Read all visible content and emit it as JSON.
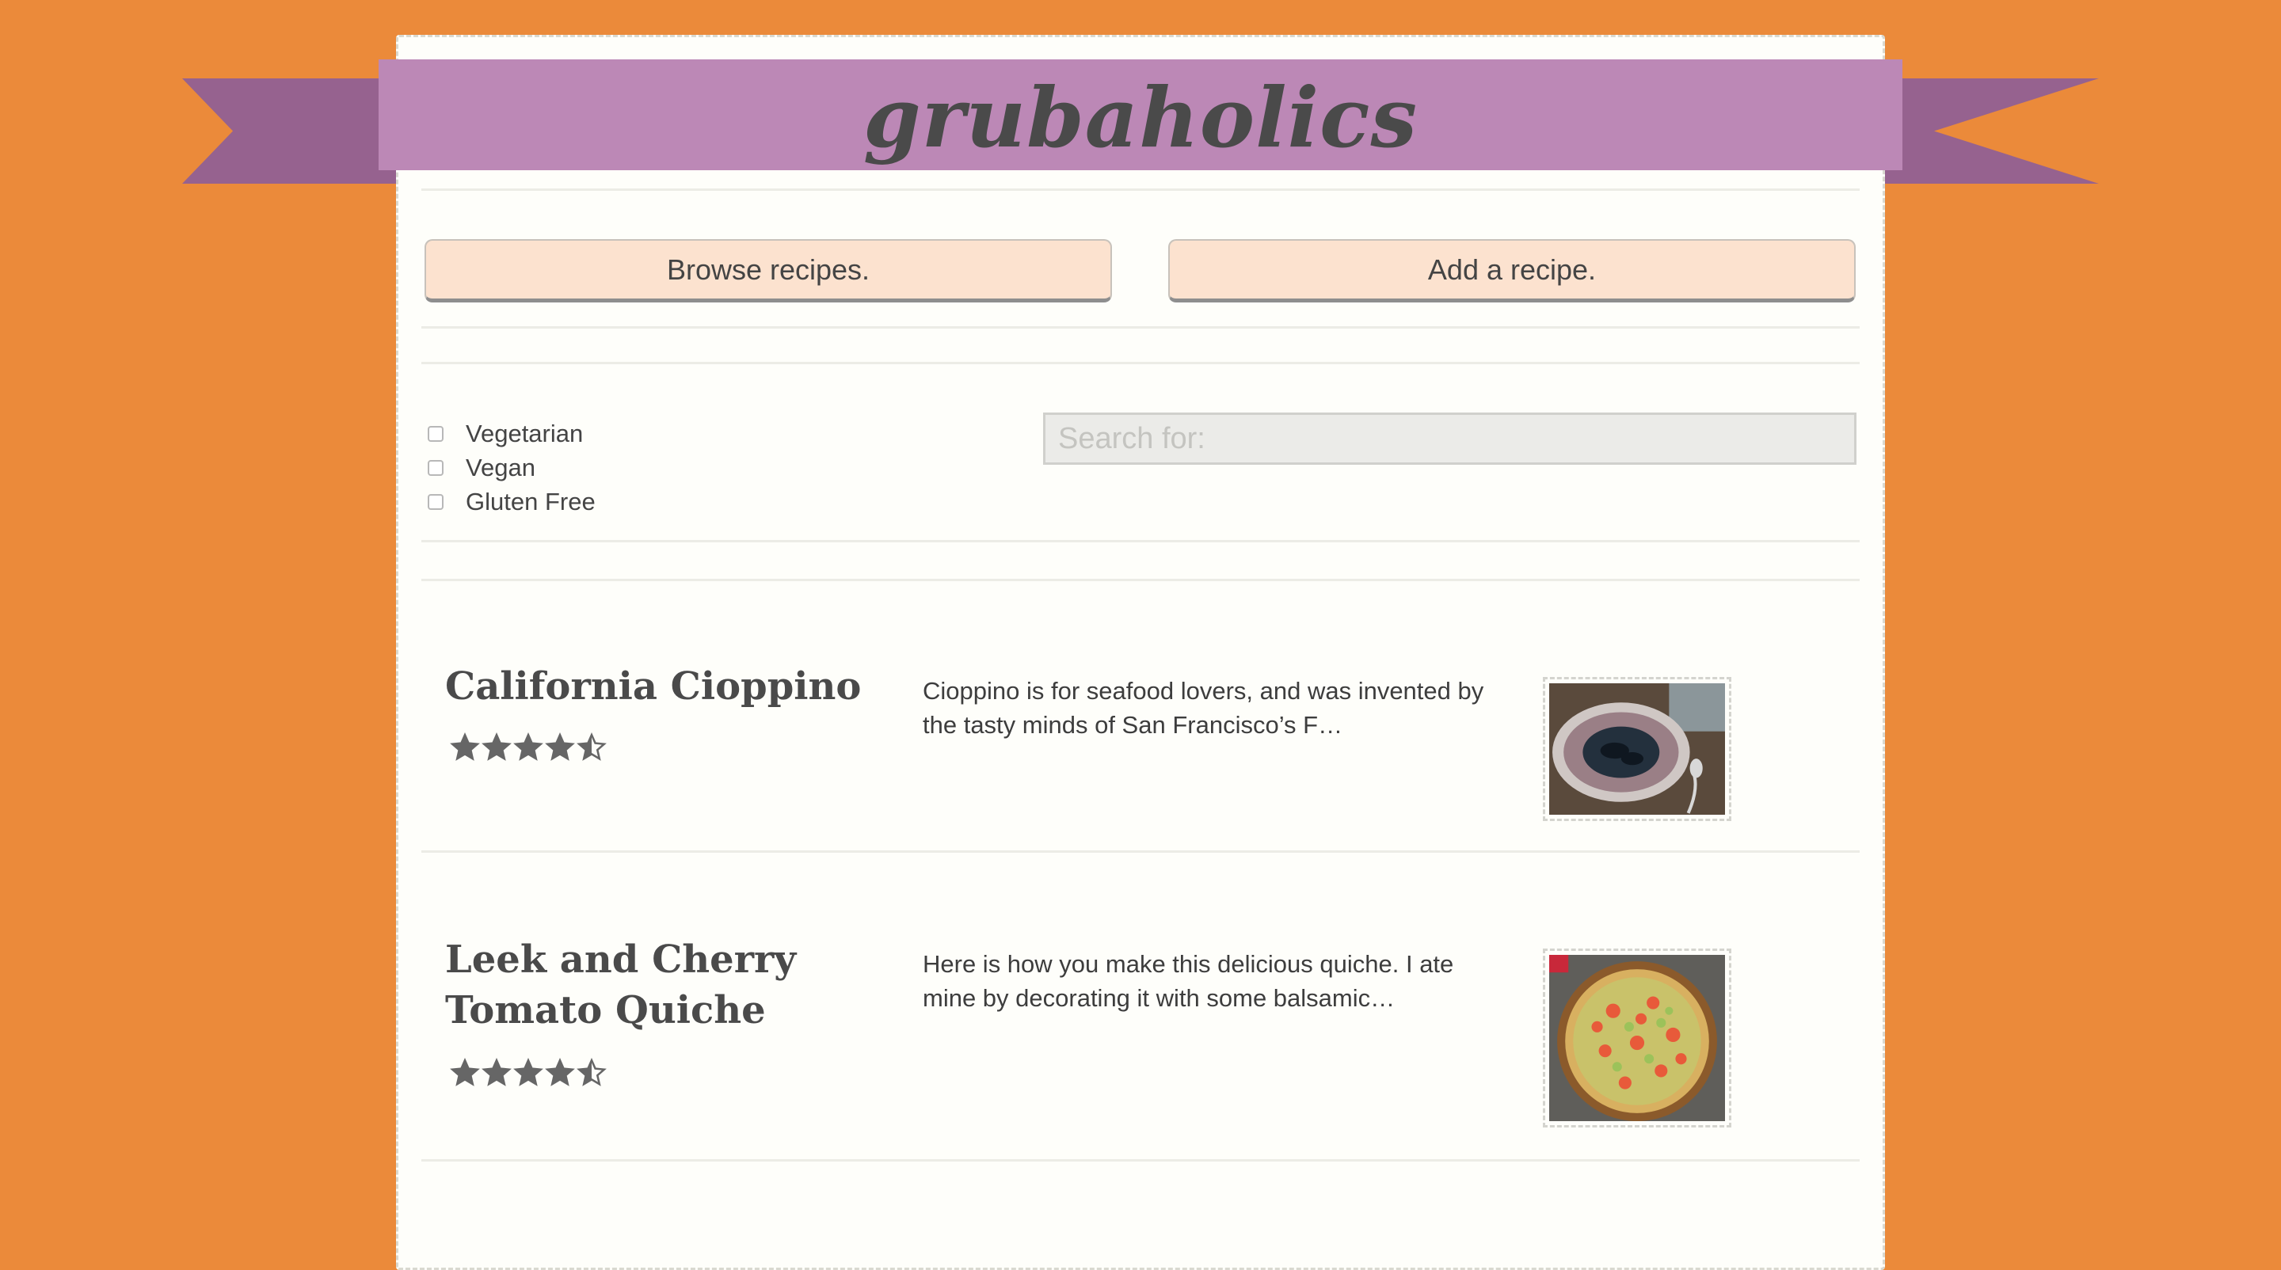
{
  "brand": {
    "name": "grubaholics"
  },
  "actions": {
    "browse_label": "Browse recipes.",
    "add_label": "Add a recipe."
  },
  "filters": {
    "options": [
      {
        "label": "Vegetarian",
        "checked": false
      },
      {
        "label": "Vegan",
        "checked": false
      },
      {
        "label": "Gluten Free",
        "checked": false
      }
    ],
    "search_placeholder": "Search for:"
  },
  "recipes": [
    {
      "title": "California Cioppino",
      "rating": 4.5,
      "description": "Cioppino is for seafood lovers, and was invented by the tasty minds of San Francisco’s F…",
      "image_icon": "cioppino-bowl"
    },
    {
      "title": "Leek and Cherry Tomato Quiche",
      "rating": 4.5,
      "description": "Here is how you make this delicious quiche. I ate mine by decorating it with some balsamic…",
      "image_icon": "quiche"
    }
  ],
  "colors": {
    "background": "#eb8a3a",
    "ribbon": "#bc88b6",
    "ribbon_tail": "#96628f",
    "button": "#fce2cf",
    "star": "#666666"
  }
}
